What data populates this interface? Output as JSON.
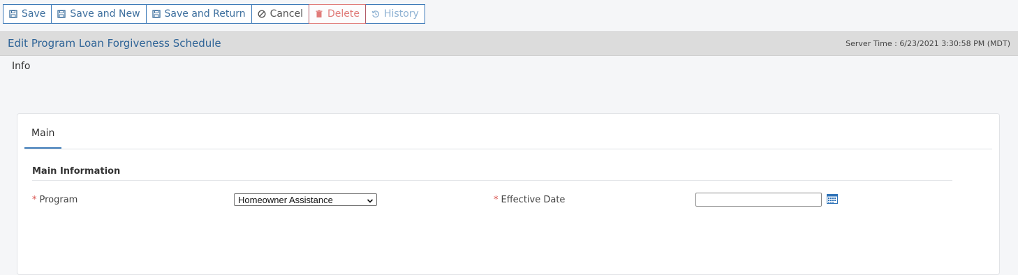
{
  "toolbar": {
    "save": "Save",
    "save_and_new": "Save and New",
    "save_and_return": "Save and Return",
    "cancel": "Cancel",
    "delete": "Delete",
    "history": "History"
  },
  "header": {
    "title": "Edit Program Loan Forgiveness Schedule",
    "server_time": "Server Time : 6/23/2021 3:30:58 PM (MDT)"
  },
  "info": {
    "label": "Info"
  },
  "card": {
    "tab_main": "Main",
    "section_title": "Main Information",
    "fields": {
      "program_label": "Program",
      "program_value": "Homeowner Assistance",
      "effective_date_label": "Effective Date",
      "effective_date_value": "",
      "required_marker": "*"
    }
  },
  "icons": {
    "save": "floppy-icon",
    "cancel": "cancel-icon",
    "delete": "trash-icon",
    "history": "history-icon",
    "calendar": "calendar-icon"
  },
  "colors": {
    "accent": "#3d7ab8",
    "title": "#2f6497",
    "danger": "#d9534f",
    "header_bg": "#dcdcdc"
  }
}
